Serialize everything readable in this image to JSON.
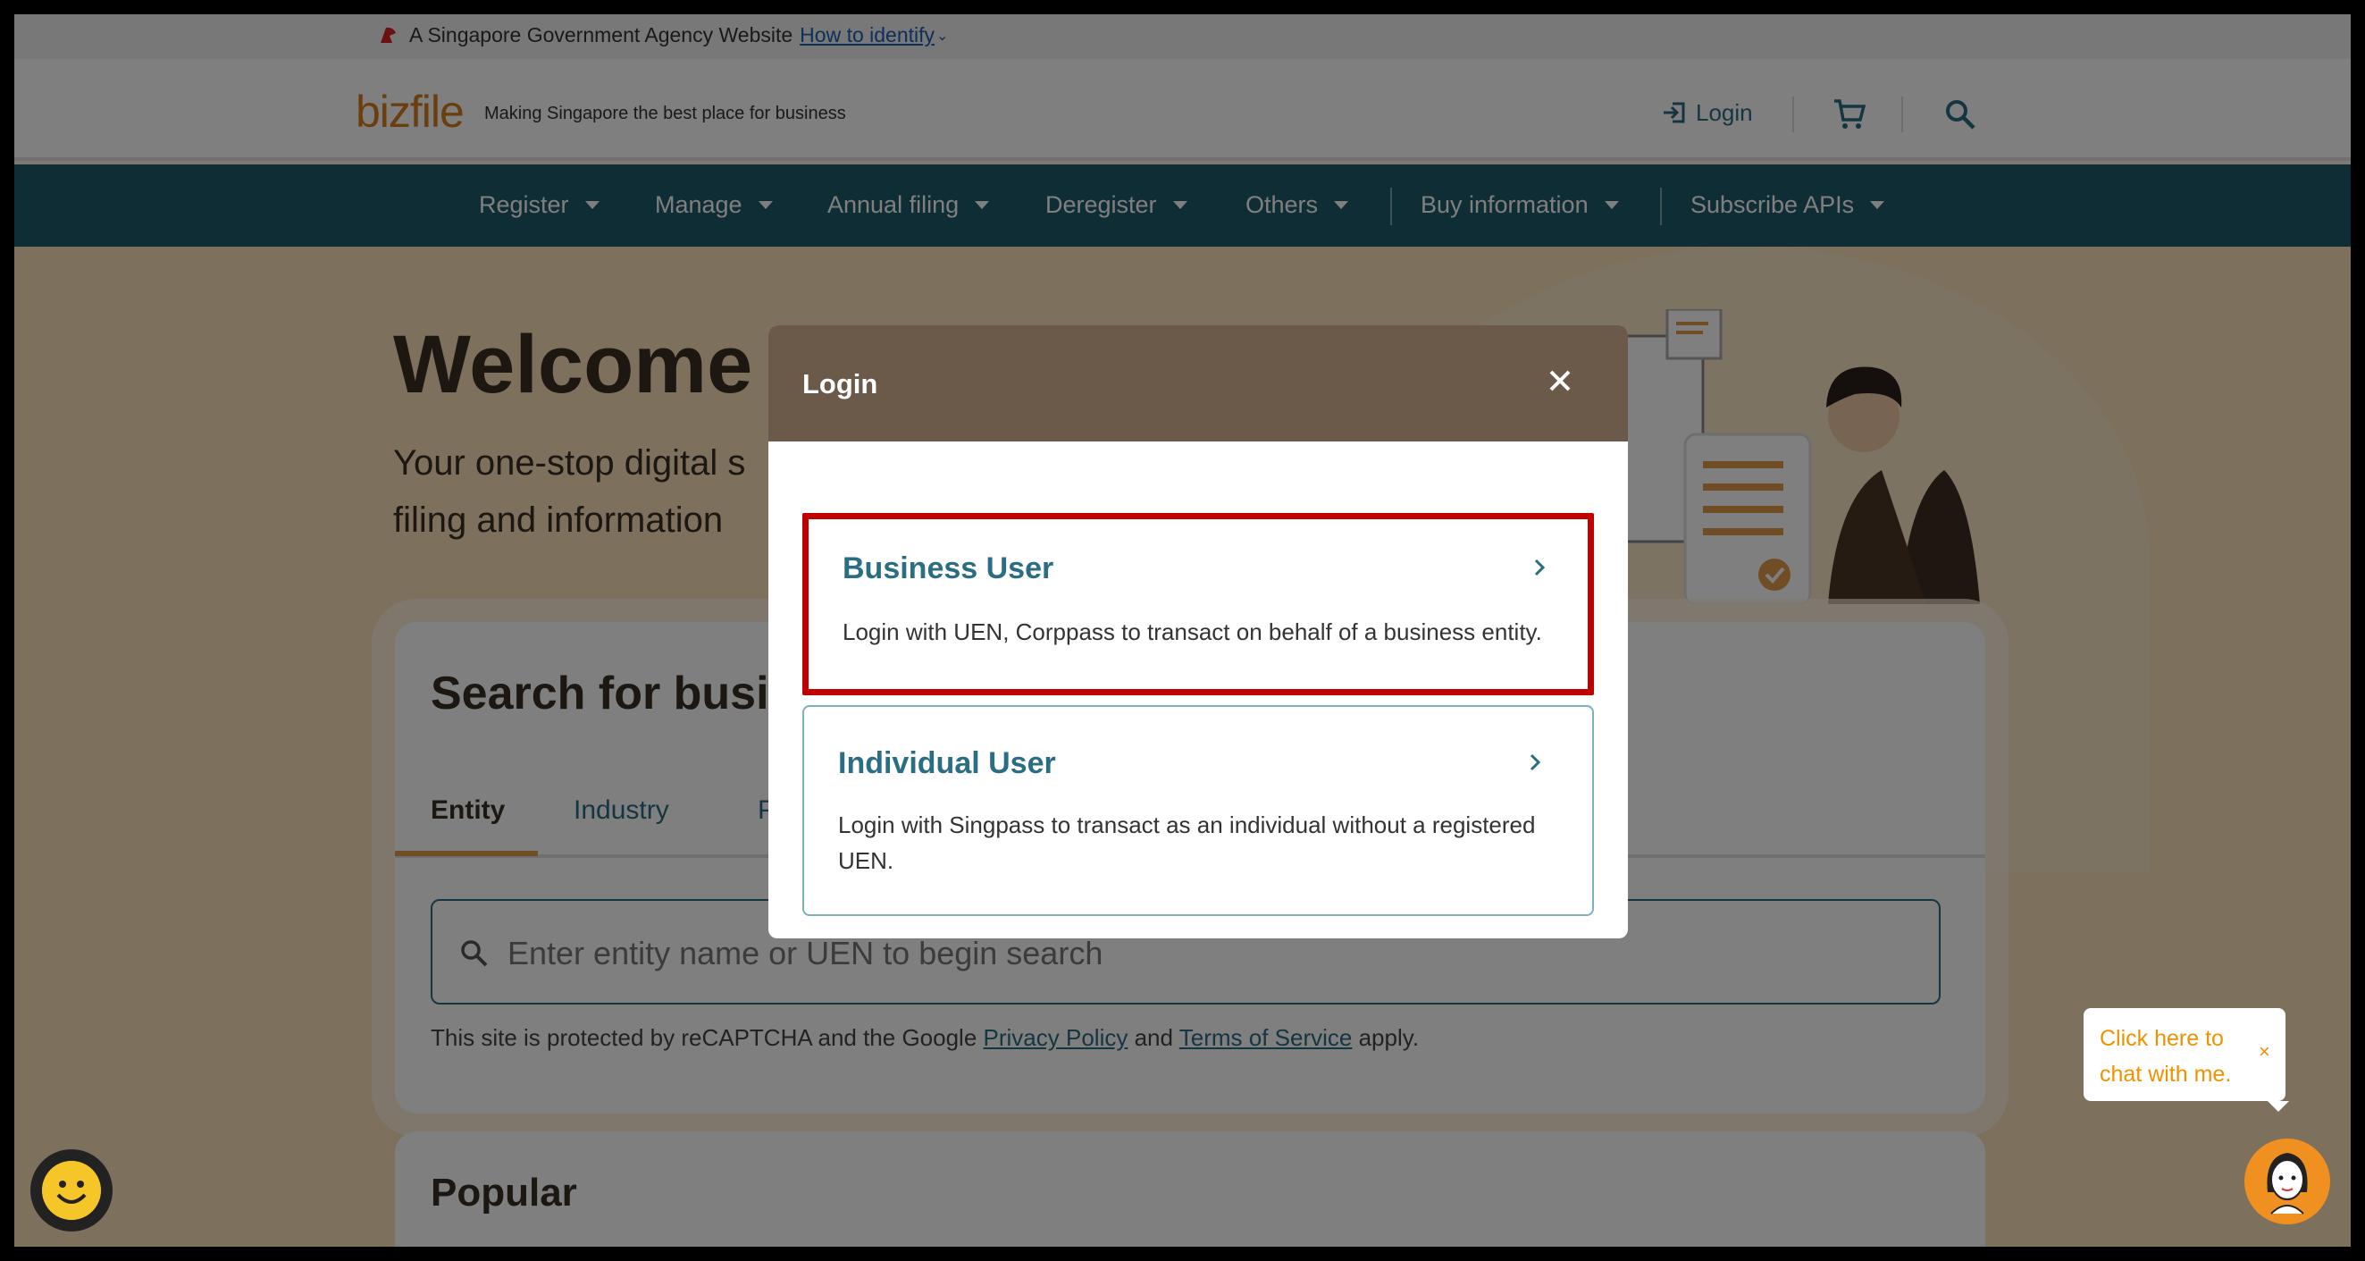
{
  "gov_banner": {
    "text": "A Singapore Government Agency Website",
    "link": "How to identify"
  },
  "header": {
    "logo": "bizfile",
    "tagline": "Making Singapore the best place for business",
    "login_label": "Login"
  },
  "nav": {
    "items": [
      {
        "label": "Register"
      },
      {
        "label": "Manage"
      },
      {
        "label": "Annual filing"
      },
      {
        "label": "Deregister"
      },
      {
        "label": "Others"
      },
      {
        "label": "Buy information"
      },
      {
        "label": "Subscribe APIs"
      }
    ]
  },
  "hero": {
    "title": "Welcome t",
    "subtitle_line1": "Your one-stop digital s",
    "subtitle_line2": "filing and information"
  },
  "search_card": {
    "title": "Search for busin",
    "tabs": [
      {
        "label": "Entity"
      },
      {
        "label": "Industry"
      },
      {
        "label": "Pe"
      }
    ],
    "placeholder": "Enter entity name or UEN to begin search",
    "legal_prefix": "This site is protected by reCAPTCHA and the Google",
    "privacy_link": "Privacy Policy",
    "legal_and": "and",
    "terms_link": "Terms of Service",
    "legal_suffix": "apply."
  },
  "popular": {
    "title": "Popular"
  },
  "modal": {
    "title": "Login",
    "options": [
      {
        "title": "Business User",
        "description": "Login with UEN, Corppass to transact on behalf of a business entity."
      },
      {
        "title": "Individual User",
        "description": "Login with Singpass to transact as an individual without a registered UEN."
      }
    ]
  },
  "chat": {
    "text": "Click here to chat with me.",
    "close": "×"
  },
  "colors": {
    "nav_bg": "#1f5a69",
    "modal_header": "#6b5a4a",
    "accent_teal": "#2b6d82",
    "logo_orange": "#d77d1c",
    "highlight_red": "#c10000",
    "chat_orange": "#f29100"
  }
}
